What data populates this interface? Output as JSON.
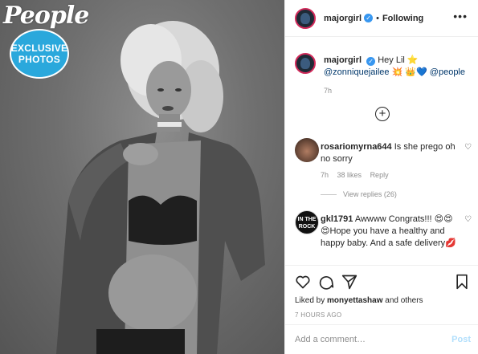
{
  "brand": {
    "logo_text": "People",
    "badge_line1": "EXCLUSIVE",
    "badge_line2": "PHOTOS",
    "badge_color": "#2aa8dc"
  },
  "post_header": {
    "username": "majorgirl",
    "verified_icon": "verified-badge-icon",
    "separator": "•",
    "follow_status": "Following",
    "more_icon": "more-options-icon"
  },
  "caption": {
    "username": "majorgirl",
    "text_before": "Hey Lil ⭐",
    "mention": "@zonniquejailee",
    "emojis": "💥 👑💙",
    "mention2": "@people",
    "time": "7h"
  },
  "load_more_icon": "plus-circle-icon",
  "comments": [
    {
      "username": "rosariomyrna644",
      "text": "Is she prego oh no sorry",
      "time": "7h",
      "likes": "38 likes",
      "reply_label": "Reply",
      "view_replies": "View replies (26)"
    },
    {
      "username": "gkl1791",
      "avatar_text": "IN THE ... ",
      "text": "Awwww Congrats!!! 😍😍😍Hope you have a healthy and happy baby. And a safe delivery💋"
    }
  ],
  "actions": {
    "like_icon": "heart-icon",
    "comment_icon": "comment-icon",
    "share_icon": "share-icon",
    "save_icon": "bookmark-icon",
    "liked_by_prefix": "Liked by",
    "liked_by_user": "monyettashaw",
    "liked_by_suffix": "and others",
    "time_ago": "7 HOURS AGO"
  },
  "add_comment": {
    "placeholder": "Add a comment…",
    "post_label": "Post",
    "post_color": "#b2dffc"
  },
  "colors": {
    "link": "#00376b",
    "muted": "#8e8e8e",
    "verified": "#3897f0"
  }
}
